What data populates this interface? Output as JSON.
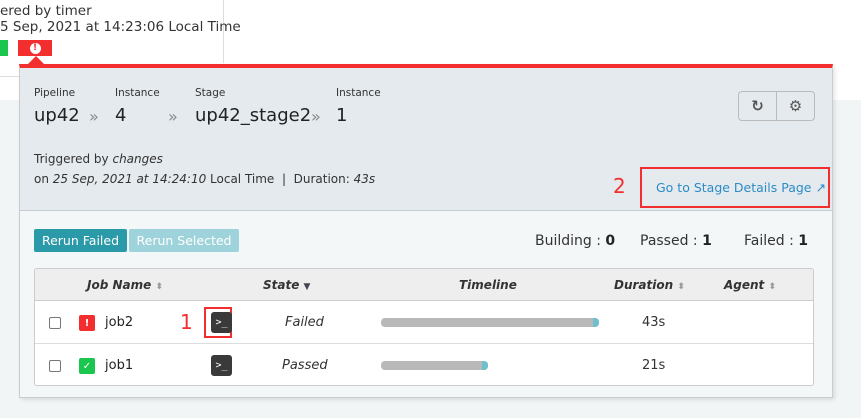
{
  "previous_instance": {
    "trigger_text": "ered by timer",
    "time_text": "5 Sep, 2021 at 14:23:06 Local Time"
  },
  "stage_popup": {
    "pipeline_label": "Pipeline",
    "pipeline": "up42",
    "instance_label": "Instance",
    "pipeline_instance": "4",
    "stage_label": "Stage",
    "stage": "up42_stage2",
    "stage_instance_label": "Instance",
    "stage_instance": "1",
    "triggered_prefix": "Triggered by ",
    "triggered_by": "changes",
    "on_prefix": "on ",
    "on_time": "25 Sep, 2021 at 14:24:10",
    "local_time": " Local Time  |  Duration: ",
    "duration": "43s",
    "stage_details_link": "Go to Stage Details Page",
    "annotation_2": "2",
    "rerun_failed": "Rerun Failed",
    "rerun_selected": "Rerun Selected",
    "counts": {
      "building_label": "Building : ",
      "building": "0",
      "passed_label": "Passed : ",
      "passed": "1",
      "failed_label": "Failed : ",
      "failed": "1"
    },
    "table": {
      "headers": [
        "Job Name",
        "State",
        "Timeline",
        "Duration",
        "Agent"
      ],
      "annotation_1": "1",
      "rows": [
        {
          "name": "job2",
          "status": "failed",
          "state": "Failed",
          "duration": "43s",
          "timeline_progress": 1.0,
          "agent": ""
        },
        {
          "name": "job1",
          "status": "passed",
          "state": "Passed",
          "duration": "21s",
          "timeline_progress": 0.49,
          "agent": ""
        }
      ]
    }
  },
  "colors": {
    "failed": "#f32e2e",
    "passed": "#1bc64f",
    "link": "#2d8bc7",
    "rerun_button": "#2b9aa8"
  }
}
